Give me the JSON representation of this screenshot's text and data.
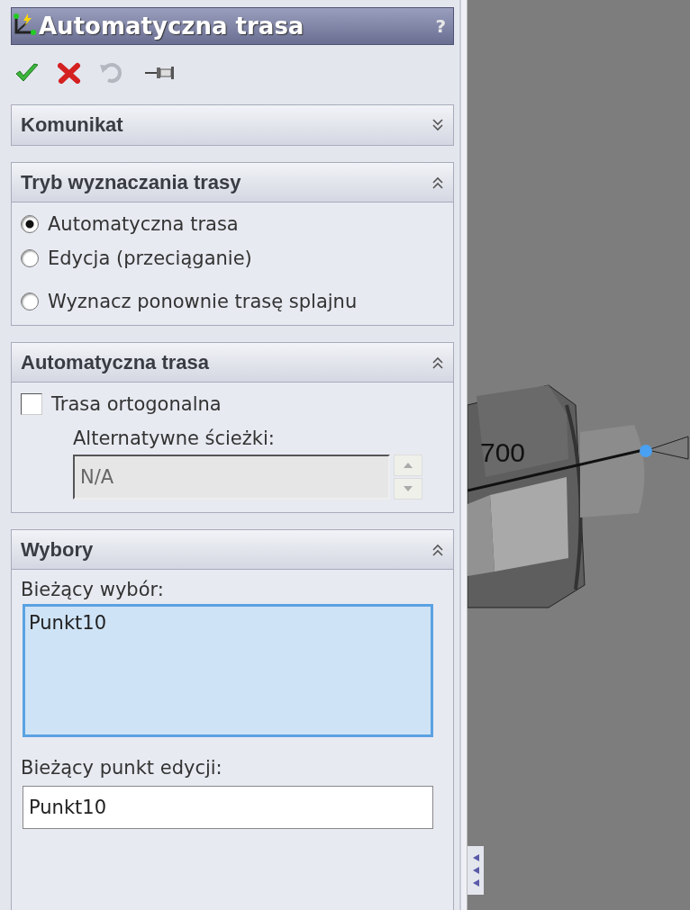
{
  "window": {
    "title": "Automatyczna trasa",
    "help": "?"
  },
  "toolbar": [
    {
      "kind": "ok"
    },
    {
      "kind": "cancel"
    },
    {
      "kind": "undo",
      "disabled": true
    },
    {
      "kind": "pin"
    }
  ],
  "sections": [
    {
      "title": "Komunikat",
      "expanded": false
    },
    {
      "kind": "radios",
      "title": "Tryb wyznaczania trasy",
      "expanded": true,
      "options": [
        {
          "label": "Automatyczna trasa",
          "selected": true
        },
        {
          "label": "Edycja (przeciąganie)",
          "selected": false
        },
        {
          "label": "Wyznacz ponownie trasę splajnu",
          "selected": false
        }
      ]
    },
    {
      "kind": "route",
      "title": "Automatyczna trasa",
      "expanded": true,
      "checkbox": {
        "label": "Trasa ortogonalna",
        "checked": false
      },
      "field_label": "Alternatywne ścieżki:",
      "field": {
        "value": "N/A",
        "disabled": true
      }
    },
    {
      "kind": "selections",
      "title": "Wybory",
      "expanded": true,
      "list_label": "Bieżący wybór:",
      "list": [
        "Punkt10"
      ],
      "field_label": "Bieżący punkt edycji:",
      "field_value": "Punkt10"
    }
  ],
  "viewport": {
    "dimension": "700"
  }
}
